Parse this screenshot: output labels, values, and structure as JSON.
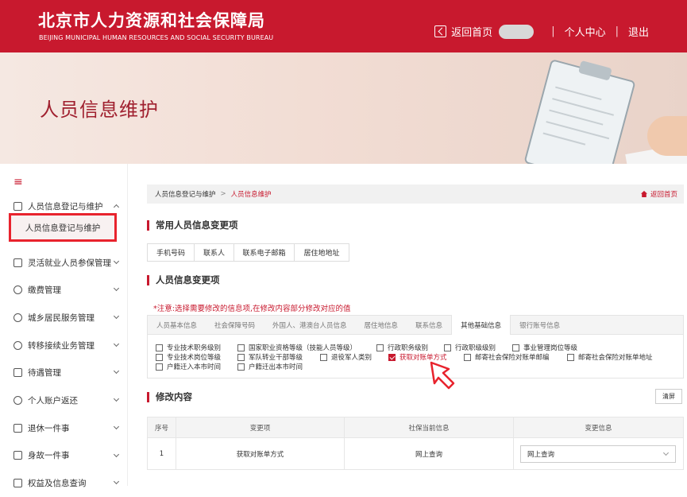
{
  "header": {
    "title": "北京市人力资源和社会保障局",
    "subtitle": "BEIJING MUNICIPAL HUMAN RESOURCES AND SOCIAL SECURITY BUREAU",
    "home": "返回首页",
    "sep": "|",
    "personal": "个人中心",
    "logout": "退出"
  },
  "banner": {
    "title": "人员信息维护"
  },
  "sidebar": {
    "collapse_icon": "menu-collapse-icon",
    "items": [
      {
        "label": "人员信息登记与维护",
        "icon": "person-card-icon",
        "expanded": true
      },
      {
        "label": "灵活就业人员参保管理",
        "icon": "person-badge-icon"
      },
      {
        "label": "缴费管理",
        "icon": "coin-icon"
      },
      {
        "label": "城乡居民服务管理",
        "icon": "globe-icon"
      },
      {
        "label": "转移接续业务管理",
        "icon": "transfer-icon"
      },
      {
        "label": "待遇管理",
        "icon": "document-icon"
      },
      {
        "label": "个人账户返还",
        "icon": "user-icon"
      },
      {
        "label": "退休一件事",
        "icon": "clipboard-icon"
      },
      {
        "label": "身故一件事",
        "icon": "file-icon"
      },
      {
        "label": "权益及信息查询",
        "icon": "search-icon"
      }
    ],
    "subitem": "人员信息登记与维护"
  },
  "breadcrumb": {
    "parent": "人员信息登记与维护",
    "gt": ">",
    "current": "人员信息维护",
    "back": "返回首页"
  },
  "common": {
    "title": "常用人员信息变更项",
    "buttons": [
      "手机号码",
      "联系人",
      "联系电子邮箱",
      "居住地地址"
    ]
  },
  "change": {
    "title": "人员信息变更项",
    "notice": "*注意:选择需要修改的信息项,在修改内容部分修改对应的值",
    "tabs": [
      "人员基本信息",
      "社会保障号码",
      "外国人、港澳台人员信息",
      "居住地信息",
      "联系信息",
      "其他基础信息",
      "银行账号信息"
    ],
    "active_tab": "其他基础信息",
    "checkboxes": [
      {
        "label": "专业技术职务级别",
        "checked": false
      },
      {
        "label": "国家职业资格等级（技能人员等级）",
        "checked": false
      },
      {
        "label": "行政职务级别",
        "checked": false
      },
      {
        "label": "行政职级级别",
        "checked": false
      },
      {
        "label": "事业管理岗位等级",
        "checked": false
      },
      {
        "label": "专业技术岗位等级",
        "checked": false
      },
      {
        "label": "军队转业干部等级",
        "checked": false
      },
      {
        "label": "退役军人类别",
        "checked": false
      },
      {
        "label": "获取对账单方式",
        "checked": true
      },
      {
        "label": "邮寄社会保险对账单邮编",
        "checked": false
      },
      {
        "label": "邮寄社会保险对账单地址",
        "checked": false
      },
      {
        "label": "户籍迁入本市时间",
        "checked": false
      },
      {
        "label": "户籍迁出本市时间",
        "checked": false
      }
    ]
  },
  "modify": {
    "title": "修改内容",
    "clear": "清屏",
    "headers": [
      "序号",
      "变更项",
      "社保当前信息",
      "变更信息"
    ],
    "rows": [
      {
        "no": "1",
        "item": "获取对账单方式",
        "current": "网上查询",
        "new": "网上查询"
      }
    ]
  },
  "colors": {
    "brand": "#c8192e",
    "highlight": "#e8232d"
  }
}
